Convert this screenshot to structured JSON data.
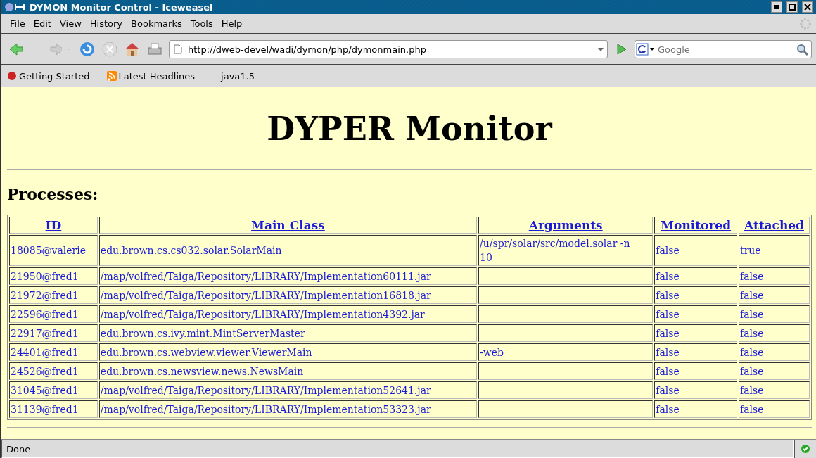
{
  "window": {
    "title": "DYMON Monitor Control - Iceweasel"
  },
  "menu": [
    "File",
    "Edit",
    "View",
    "History",
    "Bookmarks",
    "Tools",
    "Help"
  ],
  "address": {
    "value": "http://dweb-devel/wadi/dymon/php/dymonmain.php"
  },
  "search": {
    "placeholder": "Google"
  },
  "bookmarks": [
    "Getting Started",
    "Latest Headlines",
    "java1.5"
  ],
  "page": {
    "heading": "DYPER Monitor",
    "section": "Processes:"
  },
  "table": {
    "columns": [
      "ID",
      "Main Class",
      "Arguments",
      "Monitored",
      "Attached"
    ],
    "rows": [
      [
        "18085@valerie",
        "edu.brown.cs.cs032.solar.SolarMain",
        "/u/spr/solar/src/model.solar -n 10",
        "false",
        "true"
      ],
      [
        "21950@fred1",
        "/map/volfred/Taiga/Repository/LIBRARY/Implementation60111.jar",
        "",
        "false",
        "false"
      ],
      [
        "21972@fred1",
        "/map/volfred/Taiga/Repository/LIBRARY/Implementation16818.jar",
        "",
        "false",
        "false"
      ],
      [
        "22596@fred1",
        "/map/volfred/Taiga/Repository/LIBRARY/Implementation4392.jar",
        "",
        "false",
        "false"
      ],
      [
        "22917@fred1",
        "edu.brown.cs.ivy.mint.MintServerMaster",
        "",
        "false",
        "false"
      ],
      [
        "24401@fred1",
        "edu.brown.cs.webview.viewer.ViewerMain",
        "-web",
        "false",
        "false"
      ],
      [
        "24526@fred1",
        "edu.brown.cs.newsview.news.NewsMain",
        "",
        "false",
        "false"
      ],
      [
        "31045@fred1",
        "/map/volfred/Taiga/Repository/LIBRARY/Implementation52641.jar",
        "",
        "false",
        "false"
      ],
      [
        "31139@fred1",
        "/map/volfred/Taiga/Repository/LIBRARY/Implementation53323.jar",
        "",
        "false",
        "false"
      ]
    ]
  },
  "status_bar": {
    "text": "Done"
  }
}
